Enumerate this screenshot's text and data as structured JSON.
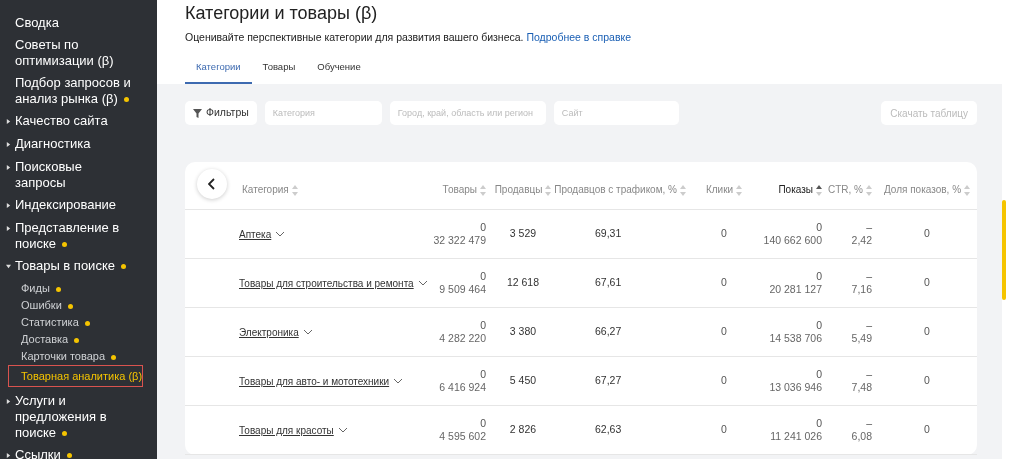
{
  "sidebar": {
    "items": [
      {
        "label": "Сводка",
        "kind": "link",
        "dot": false
      },
      {
        "label": "Советы по оптимизации (β)",
        "kind": "link",
        "dot": false
      },
      {
        "label": "Подбор запросов и анализ рынка (β)",
        "kind": "link",
        "dot": true
      },
      {
        "label": "Качество сайта",
        "kind": "group",
        "expanded": false,
        "dot": false
      },
      {
        "label": "Диагностика",
        "kind": "group",
        "expanded": false,
        "dot": false
      },
      {
        "label": "Поисковые запросы",
        "kind": "group",
        "expanded": false,
        "dot": false
      },
      {
        "label": "Индексирование",
        "kind": "group",
        "expanded": false,
        "dot": false
      },
      {
        "label": "Представление в поиске",
        "kind": "group",
        "expanded": false,
        "dot": true
      },
      {
        "label": "Товары в поиске",
        "kind": "group",
        "expanded": true,
        "dot": true,
        "children": [
          {
            "label": "Фиды",
            "dot": true,
            "selected": false
          },
          {
            "label": "Ошибки",
            "dot": true,
            "selected": false
          },
          {
            "label": "Статистика",
            "dot": true,
            "selected": false
          },
          {
            "label": "Доставка",
            "dot": true,
            "selected": false
          },
          {
            "label": "Карточки товара",
            "dot": true,
            "selected": false
          },
          {
            "label": "Товарная аналитика (β)",
            "dot": false,
            "selected": true
          }
        ]
      },
      {
        "label": "Услуги и предложения в поиске",
        "kind": "group",
        "expanded": false,
        "dot": true
      },
      {
        "label": "Ссылки",
        "kind": "group",
        "expanded": false,
        "dot": true
      }
    ]
  },
  "page": {
    "title": "Категории и товары (β)",
    "description": "Оценивайте перспективные категории для развития вашего бизнеса.",
    "help_link": "Подробнее в справке"
  },
  "tabs": [
    {
      "label": "Категории",
      "selected": true
    },
    {
      "label": "Товары",
      "selected": false
    },
    {
      "label": "Обучение",
      "selected": false
    }
  ],
  "filters": {
    "button": "Фильтры",
    "fields": [
      {
        "placeholder": "Категория"
      },
      {
        "placeholder": "Город, край, область или регион"
      },
      {
        "placeholder": "Сайт"
      }
    ],
    "download": "Скачать таблицу"
  },
  "table": {
    "columns": [
      {
        "label": "Категория",
        "sorted": false
      },
      {
        "label": "Товары",
        "sorted": false
      },
      {
        "label": "Продавцы",
        "sorted": false
      },
      {
        "label": "Продавцов с трафиком, %",
        "sorted": false
      },
      {
        "label": "Клики",
        "sorted": false
      },
      {
        "label": "Показы",
        "sorted": true
      },
      {
        "label": "CTR, %",
        "sorted": false
      },
      {
        "label": "Доля показов, %",
        "sorted": false
      }
    ],
    "rows": [
      {
        "category": "Аптека",
        "goods": [
          "0",
          "32 322 479"
        ],
        "sellers": "3 529",
        "traffic": "69,31",
        "clicks": "0",
        "shows": [
          "0",
          "140 662 600"
        ],
        "ctr": [
          "–",
          "2,42"
        ],
        "share": "0"
      },
      {
        "category": "Товары для строительства и ремонта",
        "goods": [
          "0",
          "9 509 464"
        ],
        "sellers": "12 618",
        "traffic": "67,61",
        "clicks": "0",
        "shows": [
          "0",
          "20 281 127"
        ],
        "ctr": [
          "–",
          "7,16"
        ],
        "share": "0"
      },
      {
        "category": "Электроника",
        "goods": [
          "0",
          "4 282 220"
        ],
        "sellers": "3 380",
        "traffic": "66,27",
        "clicks": "0",
        "shows": [
          "0",
          "14 538 706"
        ],
        "ctr": [
          "–",
          "5,49"
        ],
        "share": "0"
      },
      {
        "category": "Товары для авто- и мототехники",
        "goods": [
          "0",
          "6 416 924"
        ],
        "sellers": "5 450",
        "traffic": "67,27",
        "clicks": "0",
        "shows": [
          "0",
          "13 036 946"
        ],
        "ctr": [
          "–",
          "7,48"
        ],
        "share": "0"
      },
      {
        "category": "Товары для красоты",
        "goods": [
          "0",
          "4 595 602"
        ],
        "sellers": "2 826",
        "traffic": "62,63",
        "clicks": "0",
        "shows": [
          "0",
          "11 241 026"
        ],
        "ctr": [
          "–",
          "6,08"
        ],
        "share": "0"
      }
    ]
  }
}
